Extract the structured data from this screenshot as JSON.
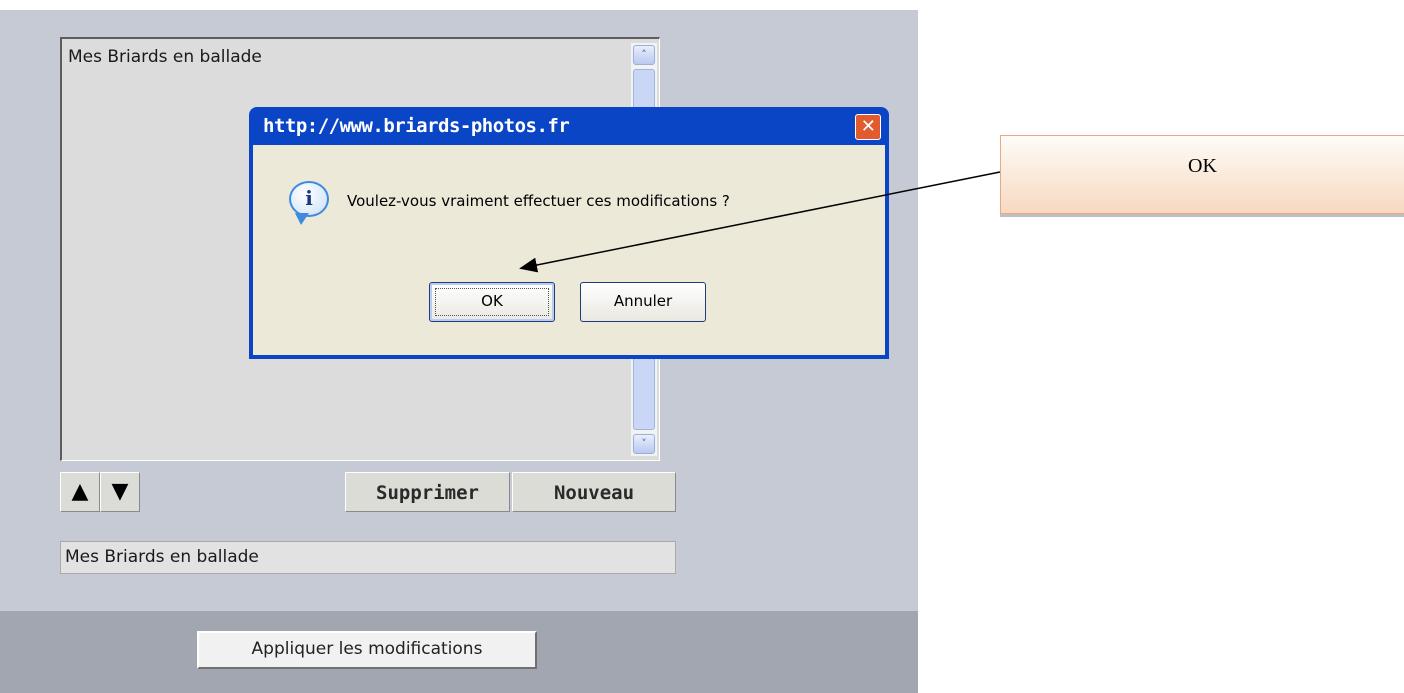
{
  "list": {
    "items": [
      "Mes Briards en ballade"
    ],
    "scroll_up_glyph": "˄",
    "scroll_down_glyph": "˅"
  },
  "toolbar": {
    "up_glyph": "▲",
    "down_glyph": "▼",
    "delete_label": "Supprimer",
    "new_label": "Nouveau"
  },
  "name_field": {
    "value": "Mes Briards en ballade"
  },
  "apply_label": "Appliquer les modifications",
  "dialog": {
    "title": "http://www.briards-photos.fr",
    "close_glyph": "✕",
    "icon_glyph": "i",
    "message": "Voulez-vous vraiment effectuer ces modifications ?",
    "ok_label": "OK",
    "cancel_label": "Annuler"
  },
  "callout": {
    "label": "OK"
  },
  "colors": {
    "panel": "#c6cad4",
    "footer": "#a1a6b0",
    "dialog_title_bar": "#0a45c6",
    "close_button": "#e25b2e",
    "callout_fill": "#f7d9c0"
  }
}
